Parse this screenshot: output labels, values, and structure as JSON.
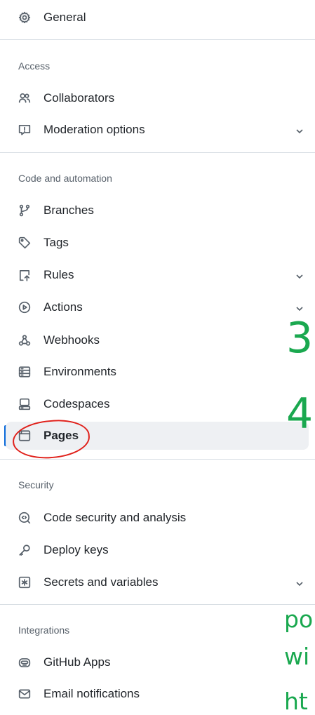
{
  "general": {
    "label": "General",
    "icon": "gear-icon"
  },
  "sections": {
    "access": "Access",
    "code_automation": "Code and automation",
    "security": "Security",
    "integrations": "Integrations"
  },
  "access_items": [
    {
      "label": "Collaborators",
      "icon": "people-icon"
    },
    {
      "label": "Moderation options",
      "icon": "report-icon",
      "expandable": true
    }
  ],
  "code_items": [
    {
      "label": "Branches",
      "icon": "git-branch-icon"
    },
    {
      "label": "Tags",
      "icon": "tag-icon"
    },
    {
      "label": "Rules",
      "icon": "repo-push-icon",
      "expandable": true
    },
    {
      "label": "Actions",
      "icon": "play-icon",
      "expandable": true
    },
    {
      "label": "Webhooks",
      "icon": "webhook-icon"
    },
    {
      "label": "Environments",
      "icon": "server-icon"
    },
    {
      "label": "Codespaces",
      "icon": "codespaces-icon"
    },
    {
      "label": "Pages",
      "icon": "browser-icon",
      "active": true
    }
  ],
  "security_items": [
    {
      "label": "Code security and analysis",
      "icon": "codescan-icon"
    },
    {
      "label": "Deploy keys",
      "icon": "key-icon"
    },
    {
      "label": "Secrets and variables",
      "icon": "key-asterisk-icon",
      "expandable": true
    }
  ],
  "integration_items": [
    {
      "label": "GitHub Apps",
      "icon": "hubot-icon"
    },
    {
      "label": "Email notifications",
      "icon": "mail-icon"
    }
  ],
  "overlay_text": {
    "n3": "3",
    "n4": "4",
    "po": "po",
    "wi": "wi",
    "ht": "ht"
  },
  "colors": {
    "active_bar": "#0969da",
    "annotation": "#e0201a",
    "overlay_green": "#1aa84f"
  }
}
